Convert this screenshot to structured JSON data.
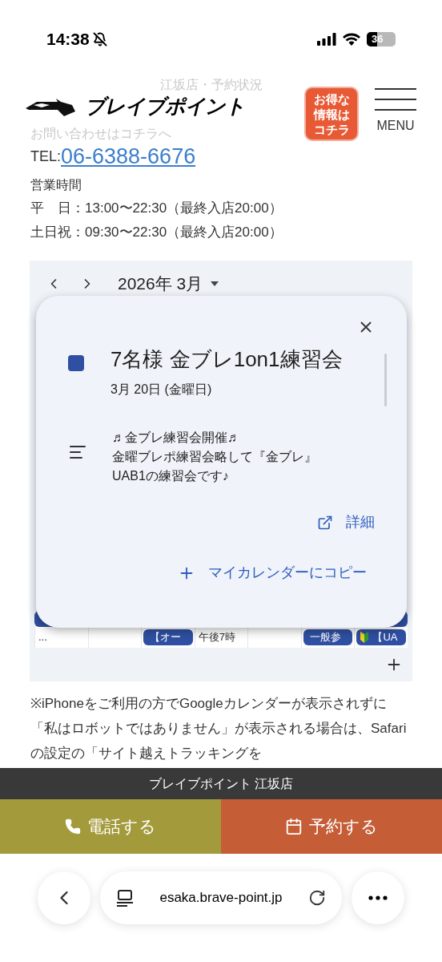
{
  "status_bar": {
    "time": "14:38",
    "battery": "36"
  },
  "header": {
    "subtitle": "江坂店・予約状況",
    "logo": "ブレイブポイント",
    "promo": "お得な情報はコチラ",
    "menu": "MENU"
  },
  "contact": {
    "heading": "お問い合わせはコチラへ",
    "tel_label": "TEL:",
    "tel": "06-6388-6676",
    "hours_title": "営業時間",
    "hours": [
      {
        "day": "平　日",
        "time": "：13:00〜22:30（最終入店20:00）"
      },
      {
        "day": "土日祝",
        "time": "：09:30〜22:30（最終入店20:00）"
      }
    ]
  },
  "calendar": {
    "month": "2026年 3月",
    "cells": [
      {
        "text": "...",
        "kind": "plain"
      },
      {
        "text": "",
        "kind": "empty"
      },
      {
        "text": "【オー",
        "kind": "chip"
      },
      {
        "text": "午後7時",
        "kind": "plain"
      },
      {
        "text": "",
        "kind": "empty"
      },
      {
        "text": "一般参",
        "kind": "chip"
      },
      {
        "text": "【UA",
        "kind": "beginner"
      }
    ]
  },
  "event_popup": {
    "color": "#2f4fa2",
    "title": "7名様 金ブレ1on1練習会",
    "date": "3月 20日 (金曜日)",
    "description": [
      "♬金ブレ練習会開催♬",
      "金曜ブレポ練習会略して『金ブレ』",
      "UAB1の練習会です♪"
    ],
    "details_link": "詳細",
    "copy_button": "マイカレンダーにコピー"
  },
  "note": "※iPhoneをご利用の方でGoogleカレンダーが表示されずに「私はロボットではありません」が表示される場合は、Safariの設定の「サイト越えトラッキングを",
  "footer_bar": {
    "title": "ブレイブポイント 江坂店",
    "call_button": "電話する",
    "reserve_button": "予約する"
  },
  "browser": {
    "url": "esaka.brave-point.jp"
  }
}
